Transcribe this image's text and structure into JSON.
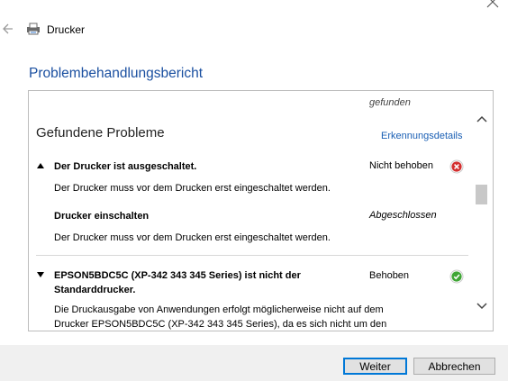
{
  "window": {
    "title": "Drucker",
    "heading": "Problembehandlungsbericht"
  },
  "report": {
    "clipped_text": "gefunden",
    "section_title": "Gefundene Probleme",
    "details_link": "Erkennungsdetails",
    "problems": [
      {
        "title": "Der Drucker ist ausgeschaltet.",
        "status": "Nicht behoben",
        "status_icon": "error-icon",
        "description": "Der Drucker muss vor dem Drucken erst eingeschaltet werden.",
        "expanded": true,
        "solution": {
          "title": "Drucker einschalten",
          "status": "Abgeschlossen",
          "description": "Der Drucker muss vor dem Drucken erst eingeschaltet werden."
        }
      },
      {
        "title_line1": "EPSON5BDC5C (XP-342 343 345 Series) ist nicht der",
        "title_line2": "Standarddrucker.",
        "status": "Behoben",
        "status_icon": "check-icon",
        "description_line1": "Die Druckausgabe von Anwendungen erfolgt möglicherweise nicht auf dem",
        "description_line2": "Drucker EPSON5BDC5C (XP-342 343 345 Series), da es sich nicht um den",
        "expanded": false
      }
    ]
  },
  "buttons": {
    "next": "Weiter",
    "cancel": "Abbrechen"
  },
  "colors": {
    "heading": "#1a4fa0",
    "link": "#1a5fb4",
    "error": "#d32f2f",
    "success": "#3fa535",
    "default_button_border": "#0078d7"
  }
}
